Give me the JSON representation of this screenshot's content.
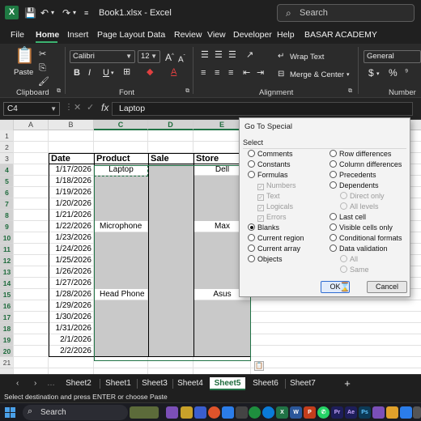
{
  "window": {
    "title": "Book1.xlsx - Excel",
    "search_placeholder": "Search"
  },
  "menu": {
    "items": [
      "File",
      "Home",
      "Insert",
      "Page Layout",
      "Data",
      "Review",
      "View",
      "Developer",
      "Help",
      "BASAR ACADEMY"
    ],
    "active": "Home"
  },
  "ribbon": {
    "paste_label": "Paste",
    "clipboard_label": "Clipboard",
    "font_name": "Calibri",
    "font_size": "12",
    "font_label": "Font",
    "wrap_text": "Wrap Text",
    "merge_center": "Merge & Center",
    "alignment_label": "Alignment",
    "number_format": "General",
    "number_label": "Number",
    "bold": "B",
    "italic": "I",
    "underline": "U",
    "grow_font": "A",
    "shrink_font": "A",
    "currency": "$",
    "percent": "%"
  },
  "formula_bar": {
    "name_box": "C4",
    "fx": "fx",
    "content": "Laptop"
  },
  "columns": [
    "A",
    "B",
    "C",
    "D",
    "E"
  ],
  "selected_columns": [
    "C",
    "D",
    "E"
  ],
  "rows": [
    "1",
    "2",
    "3",
    "4",
    "5",
    "6",
    "7",
    "8",
    "9",
    "10",
    "11",
    "12",
    "13",
    "14",
    "15",
    "16",
    "17",
    "18",
    "19",
    "20",
    "21"
  ],
  "selected_rows": [
    "4",
    "5",
    "6",
    "7",
    "8",
    "9",
    "10",
    "11",
    "12",
    "13",
    "14",
    "15",
    "16",
    "17",
    "18",
    "19",
    "20"
  ],
  "table": {
    "headers": [
      "Date",
      "Product",
      "Sale",
      "Store"
    ],
    "rows": [
      {
        "date": "1/17/2026",
        "product": "Laptop",
        "sale": "",
        "store": "Dell"
      },
      {
        "date": "1/18/2026",
        "product": "",
        "sale": "",
        "store": ""
      },
      {
        "date": "1/19/2026",
        "product": "",
        "sale": "",
        "store": ""
      },
      {
        "date": "1/20/2026",
        "product": "",
        "sale": "",
        "store": ""
      },
      {
        "date": "1/21/2026",
        "product": "",
        "sale": "",
        "store": ""
      },
      {
        "date": "1/22/2026",
        "product": "Microphone",
        "sale": "",
        "store": "Max"
      },
      {
        "date": "1/23/2026",
        "product": "",
        "sale": "",
        "store": ""
      },
      {
        "date": "1/24/2026",
        "product": "",
        "sale": "",
        "store": ""
      },
      {
        "date": "1/25/2026",
        "product": "",
        "sale": "",
        "store": ""
      },
      {
        "date": "1/26/2026",
        "product": "",
        "sale": "",
        "store": ""
      },
      {
        "date": "1/27/2026",
        "product": "",
        "sale": "",
        "store": ""
      },
      {
        "date": "1/28/2026",
        "product": "Head Phone",
        "sale": "",
        "store": "Asus"
      },
      {
        "date": "1/29/2026",
        "product": "",
        "sale": "",
        "store": ""
      },
      {
        "date": "1/30/2026",
        "product": "",
        "sale": "",
        "store": ""
      },
      {
        "date": "1/31/2026",
        "product": "",
        "sale": "",
        "store": ""
      },
      {
        "date": "2/1/2026",
        "product": "",
        "sale": "",
        "store": ""
      },
      {
        "date": "2/2/2026",
        "product": "",
        "sale": "",
        "store": ""
      }
    ]
  },
  "dialog": {
    "title": "Go To Special",
    "section": "Select",
    "left_options": [
      {
        "label": "Comments",
        "checked": false,
        "enabled": true
      },
      {
        "label": "Constants",
        "checked": false,
        "enabled": true
      },
      {
        "label": "Formulas",
        "checked": false,
        "enabled": true
      },
      {
        "label": "Blanks",
        "checked": true,
        "enabled": true
      },
      {
        "label": "Current region",
        "checked": false,
        "enabled": true
      },
      {
        "label": "Current array",
        "checked": false,
        "enabled": true
      },
      {
        "label": "Objects",
        "checked": false,
        "enabled": true
      }
    ],
    "formula_suboptions": [
      "Numbers",
      "Text",
      "Logicals",
      "Errors"
    ],
    "right_options": [
      {
        "label": "Row differences",
        "enabled": true
      },
      {
        "label": "Column differences",
        "enabled": true
      },
      {
        "label": "Precedents",
        "enabled": true
      },
      {
        "label": "Dependents",
        "enabled": true
      },
      {
        "label": "Last cell",
        "enabled": true
      },
      {
        "label": "Visible cells only",
        "enabled": true
      },
      {
        "label": "Conditional formats",
        "enabled": true
      },
      {
        "label": "Data validation",
        "enabled": true
      }
    ],
    "dependents_suboptions": [
      "Direct only",
      "All levels"
    ],
    "validation_suboptions": [
      "All",
      "Same"
    ],
    "ok_label": "OK",
    "cancel_label": "Cancel"
  },
  "sheets": {
    "tabs": [
      "Sheet2",
      "Sheet1",
      "Sheet3",
      "Sheet4",
      "Sheet5",
      "Sheet6",
      "Sheet7"
    ],
    "active": "Sheet5",
    "add": "+"
  },
  "status": {
    "text": "Select destination and press ENTER or choose Paste"
  },
  "taskbar": {
    "search_label": "Search"
  }
}
